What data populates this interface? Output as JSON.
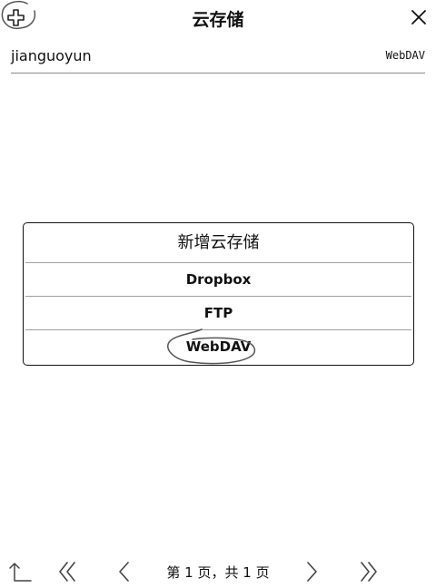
{
  "header": {
    "title": "云存储",
    "add_icon": "add-icon",
    "close_icon": "close-icon"
  },
  "storage_list": [
    {
      "name": "jianguoyun",
      "type": "WebDAV"
    }
  ],
  "dialog": {
    "title": "新增云存储",
    "options": [
      "Dropbox",
      "FTP",
      "WebDAV"
    ]
  },
  "pager": {
    "text": "第 1 页，共 1 页",
    "icons": [
      "parent-folder-icon",
      "first-page-icon",
      "prev-page-icon",
      "next-page-icon",
      "last-page-icon"
    ]
  }
}
